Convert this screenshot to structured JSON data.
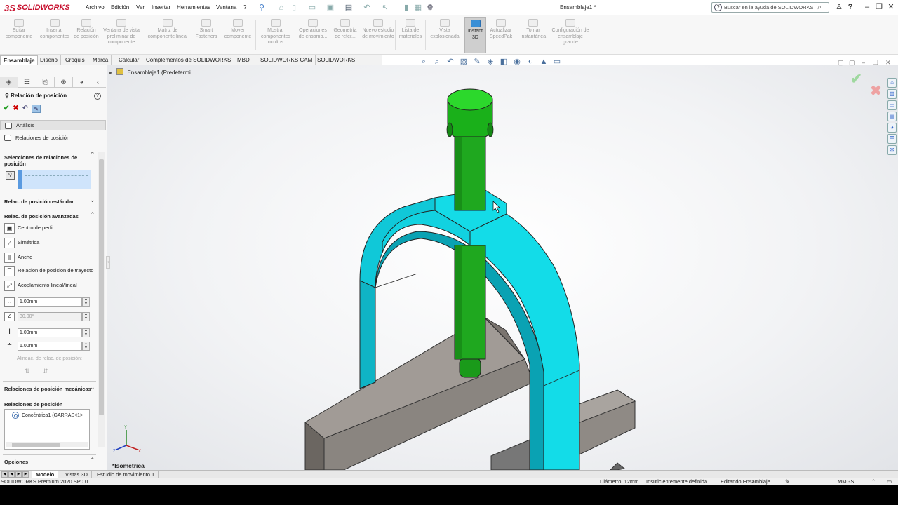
{
  "app": {
    "logo_ds": "3S",
    "logo_text": "SOLIDWORKS",
    "document_title": "Ensamblaje1 *"
  },
  "menu": [
    "Archivo",
    "Edición",
    "Ver",
    "Insertar",
    "Herramientas",
    "Ventana",
    "?"
  ],
  "search": {
    "placeholder": "Buscar en la ayuda de SOLIDWORKS"
  },
  "commands": [
    {
      "label": "Editar componente"
    },
    {
      "label": "Insertar componentes"
    },
    {
      "label": "Relación de posición"
    },
    {
      "label": "Ventana de vista preliminar de componente"
    },
    {
      "label": "Matriz de componente lineal"
    },
    {
      "label": "Smart Fasteners"
    },
    {
      "label": "Mover componente"
    },
    {
      "label": "Mostrar componentes ocultos"
    },
    {
      "label": "Operaciones de ensamb..."
    },
    {
      "label": "Geometría de refer..."
    },
    {
      "label": "Nuevo estudio de movimiento"
    },
    {
      "label": "Lista de materiales"
    },
    {
      "label": "Vista explosionada"
    },
    {
      "label": "Instant 3D"
    },
    {
      "label": "Actualizar SpeedPak"
    },
    {
      "label": "Tomar instantánea"
    },
    {
      "label": "Configuración de ensamblaje grande"
    }
  ],
  "tabs": [
    "Ensamblaje",
    "Diseño",
    "Croquis",
    "Marca",
    "Calcular",
    "Complementos de SOLIDWORKS",
    "MBD",
    "SOLIDWORKS CAM",
    "SOLIDWORKS Inspection"
  ],
  "tree": {
    "root": "Ensamblaje1  (Predetermi..."
  },
  "property_manager": {
    "title": "Relación de posición",
    "tab_analysis": "Análisis",
    "tab_mates": "Relaciones de posición",
    "sel_section": "Selecciones de relaciones de posición",
    "std_section": "Relac. de posición estándar",
    "adv_section": "Relac. de posición avanzadas",
    "advanced": [
      {
        "label": "Centro de perfil",
        "icon": "profile-center-icon"
      },
      {
        "label": "Simétrica",
        "icon": "symmetric-icon"
      },
      {
        "label": "Ancho",
        "icon": "width-icon"
      },
      {
        "label": "Relación de posición de trayecto",
        "icon": "path-mate-icon"
      },
      {
        "label": "Acoplamiento lineal/lineal",
        "icon": "linear-coupler-icon"
      }
    ],
    "distance_value": "1.00mm",
    "angle_value": "30.00°",
    "max_value": "1.00mm",
    "min_value": "1.00mm",
    "align_label": "Alineac. de relac. de posición:",
    "mech_section": "Relaciones de posición mecánicas",
    "mates_section": "Relaciones de posición",
    "mates_list": [
      "Concéntrica1 (GARRAS<1>"
    ],
    "options_section": "Opciones"
  },
  "viewport": {
    "view_name": "*Isométrica"
  },
  "bottom_tabs": [
    "Modelo",
    "Vistas 3D",
    "Estudio de movimiento 1"
  ],
  "status": {
    "product": "SOLIDWORKS Premium 2020 SP0.0",
    "diameter": "Diámetro: 12mm",
    "definition": "Insuficientemente definida",
    "editing": "Editando Ensamblaje",
    "units": "MMGS"
  },
  "colors": {
    "cyan_part": "#00e0ea",
    "green_part": "#1fa81f",
    "vise_gray": "#8a8580",
    "accent_red": "#c8102e"
  }
}
